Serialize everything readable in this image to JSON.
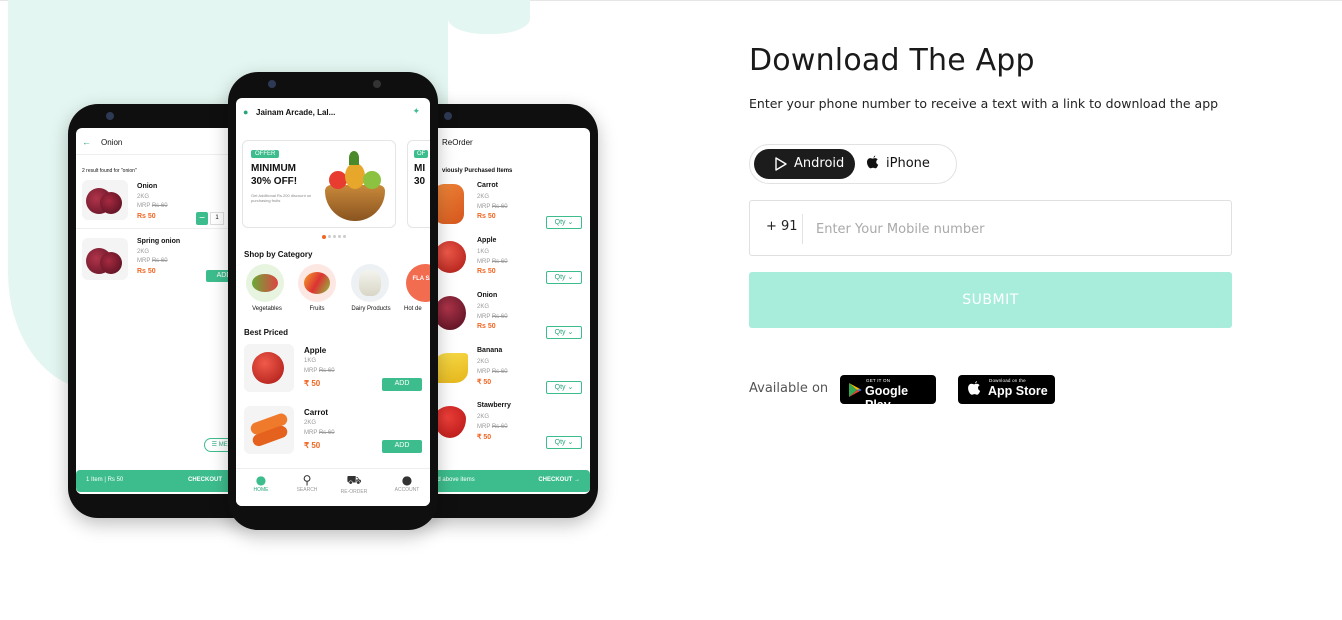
{
  "download": {
    "title": "Download The App",
    "subtitle": "Enter your phone number to receive a text with a link to download the app",
    "toggle": {
      "android": "Android",
      "iphone": "iPhone",
      "selected": "Android"
    },
    "country_code": "+ 91",
    "mobile_placeholder": "Enter Your Mobile number",
    "mobile_value": "",
    "submit_label": "SUBMIT",
    "available_on": "Available on",
    "google_play": {
      "small": "GET IT ON",
      "big": "Google Play"
    },
    "app_store": {
      "small": "Download on the",
      "big": "App Store"
    }
  },
  "colors": {
    "brand_green": "#3dbd8e",
    "submit_disabled": "#a8eddb",
    "toggle_active": "#1c1c1c",
    "blob": "#e4f6f1"
  },
  "phone_left": {
    "search_value": "Onion",
    "result_text": "2 result found for \"onion\"",
    "items": [
      {
        "name": "Onion",
        "qty": "2KG",
        "mrp_label": "MRP",
        "mrp": "Rs 60",
        "price": "Rs 50",
        "stepper_value": "1"
      },
      {
        "name": "Spring onion",
        "qty": "2KG",
        "mrp_label": "MRP",
        "mrp": "Rs 60",
        "price": "Rs 50",
        "add": "ADD"
      }
    ],
    "menu": "MENU",
    "bottom_left": "1 Item | Rs 50",
    "checkout": "CHECKOUT"
  },
  "phone_center": {
    "location": "Jainam Arcade, Lal...",
    "offer_badge": "OFFER",
    "offer_line1": "MINIMUM",
    "offer_line2": "30% OFF!",
    "offer_small": "Get Additional Rs.200 discount on purchasing fruits",
    "offer2_badge": "OF",
    "offer2_line1": "MI",
    "offer2_line2": "30",
    "shop_by_category": "Shop by Category",
    "categories": [
      "Vegetables",
      "Fruits",
      "Dairy Products",
      "Hot de"
    ],
    "flash_sale": "FLA SAL",
    "best_priced": "Best Priced",
    "items": [
      {
        "name": "Apple",
        "qty": "1KG",
        "mrp_label": "MRP",
        "mrp": "Rs 60",
        "price": "₹ 50",
        "add": "ADD"
      },
      {
        "name": "Carrot",
        "qty": "2KG",
        "mrp_label": "MRP",
        "mrp": "Rs 60",
        "price": "₹ 50",
        "add": "ADD"
      }
    ],
    "nav": [
      "HOME",
      "SEARCH",
      "RE-ORDER",
      "ACCOUNT"
    ]
  },
  "phone_right": {
    "title": "ReOrder",
    "section": "viously Purchased Items",
    "items": [
      {
        "name": "Carrot",
        "qty": "2KG",
        "mrp_label": "MRP",
        "mrp": "Rs 60",
        "price": "Rs 50",
        "qty_btn": "Qty ⌄"
      },
      {
        "name": "Apple",
        "qty": "1KG",
        "mrp_label": "MRP",
        "mrp": "Rs 60",
        "price": "Rs 50",
        "qty_btn": "Qty ⌄"
      },
      {
        "name": "Onion",
        "qty": "2KG",
        "mrp_label": "MRP",
        "mrp": "Rs 60",
        "price": "Rs 50",
        "qty_btn": "Qty ⌄"
      },
      {
        "name": "Banana",
        "qty": "2KG",
        "mrp_label": "MRP",
        "mrp": "Rs 60",
        "price": "₹ 50",
        "qty_btn": "Qty ⌄"
      },
      {
        "name": "Stawberry",
        "qty": "2KG",
        "mrp_label": "MRP",
        "mrp": "Rs 60",
        "price": "₹ 50",
        "qty_btn": "Qty ⌄"
      }
    ],
    "bottom_left": "dd above items",
    "checkout": "CHECKOUT →"
  }
}
